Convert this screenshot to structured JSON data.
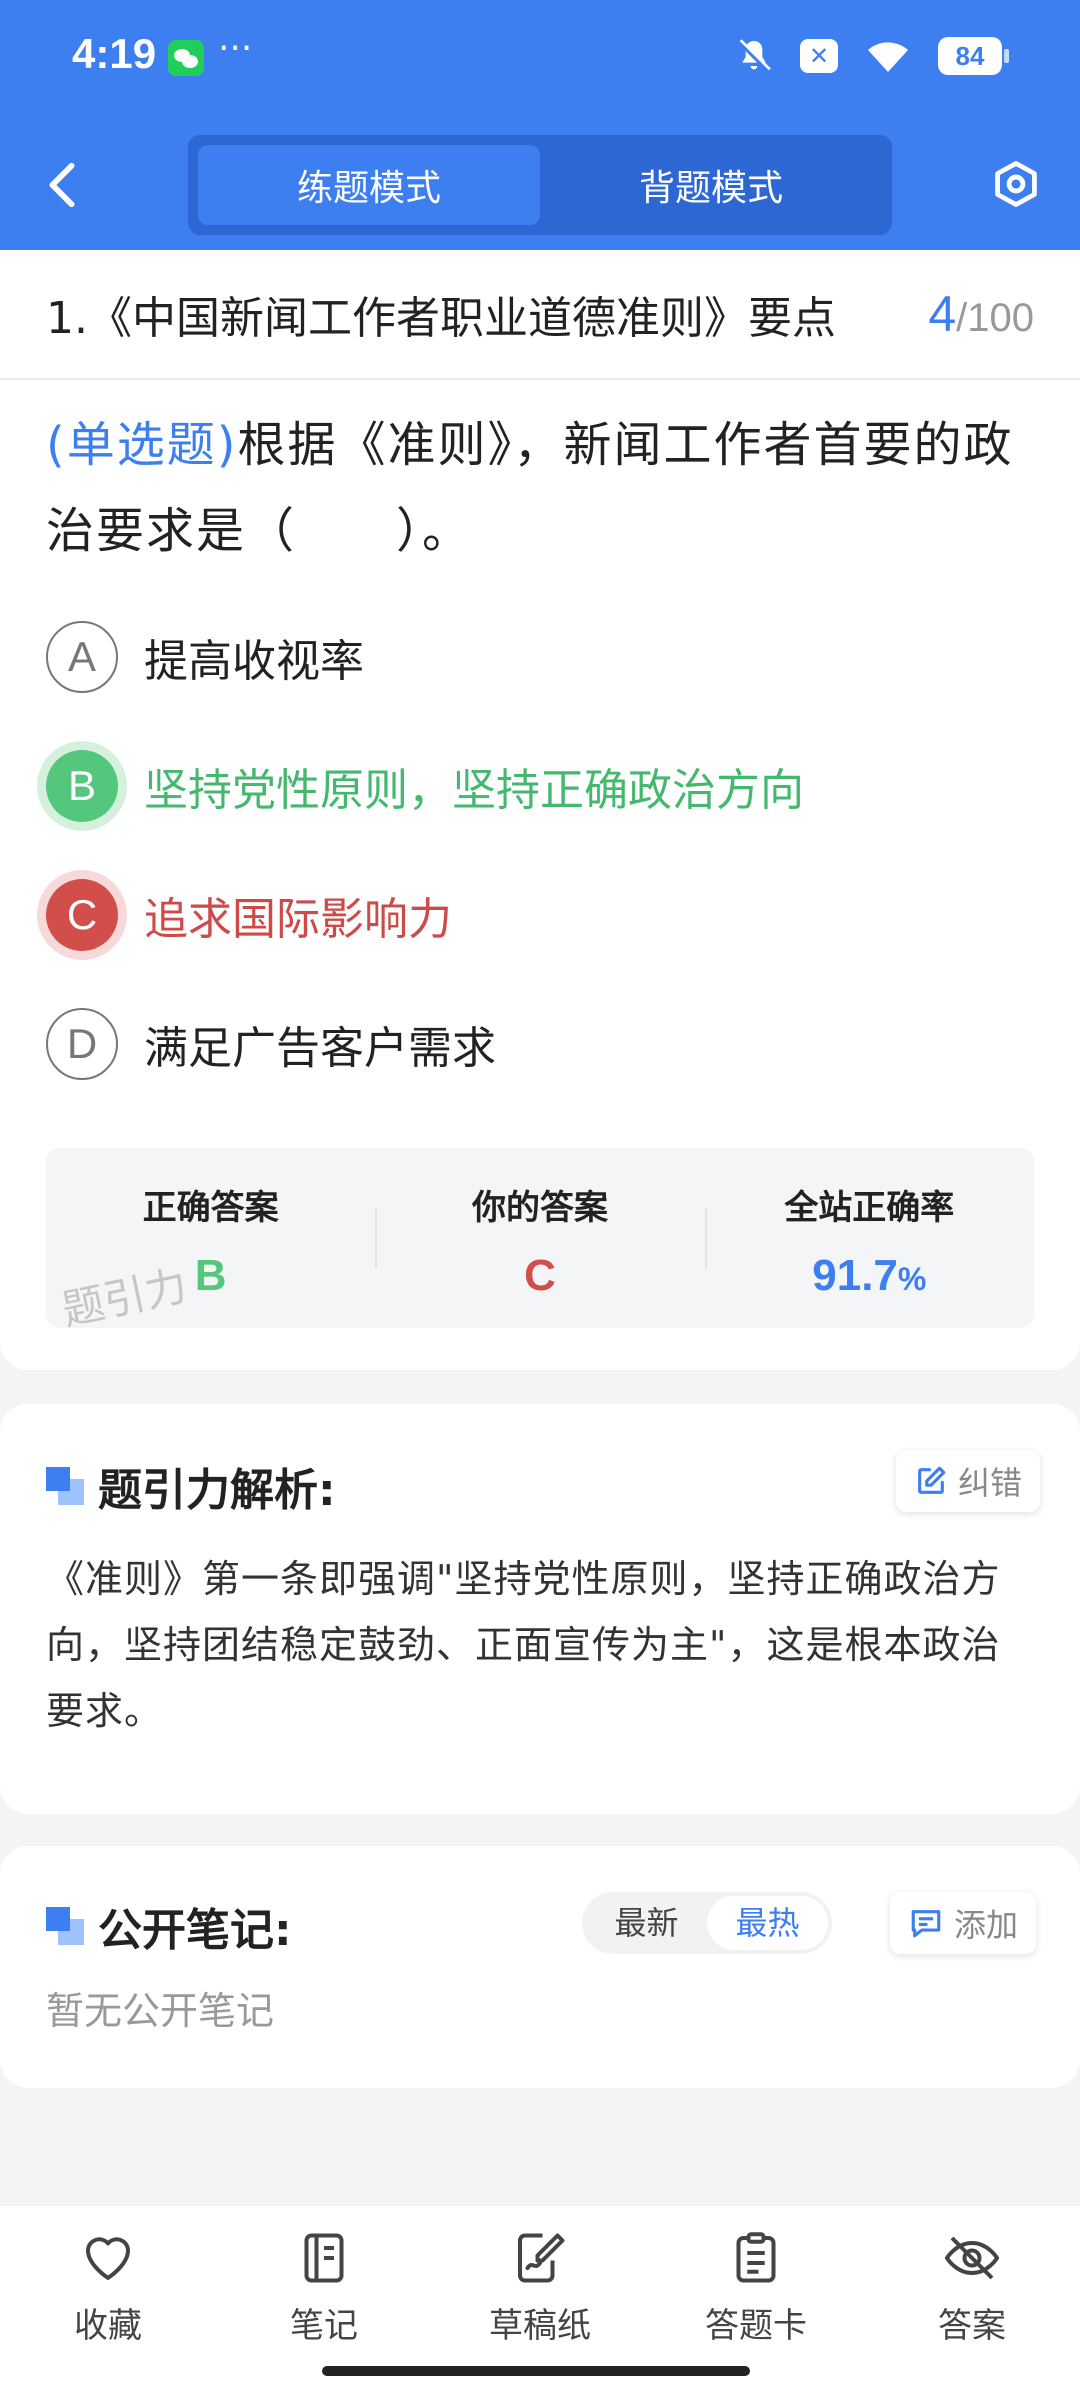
{
  "status_bar": {
    "time": "4:19",
    "dots": "···",
    "x_badge": "✕",
    "battery": "84"
  },
  "header": {
    "tabs": [
      {
        "label": "练题模式",
        "active": true
      },
      {
        "label": "背题模式",
        "active": false
      }
    ]
  },
  "question_header": {
    "title": "1.《中国新闻工作者职业道德准则》要点",
    "current": "4",
    "separator": "/",
    "total": "100"
  },
  "question": {
    "type_label": "(单选题)",
    "text": "根据《准则》，新闻工作者首要的政治要求是（　　）。",
    "options": [
      {
        "letter": "A",
        "text": "提高收视率",
        "state": "normal"
      },
      {
        "letter": "B",
        "text": "坚持党性原则，坚持正确政治方向",
        "state": "correct"
      },
      {
        "letter": "C",
        "text": "追求国际影响力",
        "state": "wrong"
      },
      {
        "letter": "D",
        "text": "满足广告客户需求",
        "state": "normal"
      }
    ]
  },
  "summary": {
    "correct_label": "正确答案",
    "correct_value": "B",
    "yours_label": "你的答案",
    "yours_value": "C",
    "rate_label": "全站正确率",
    "rate_value": "91.7",
    "rate_unit": "%",
    "watermark": "题引力"
  },
  "analysis": {
    "title": "题引力解析:",
    "report_label": "纠错",
    "text": "《准则》第一条即强调\"坚持党性原则，坚持正确政治方向，坚持团结稳定鼓劲、正面宣传为主\"，这是根本政治要求。"
  },
  "notes": {
    "title": "公开笔记:",
    "sort_options": [
      {
        "label": "最新",
        "active": false
      },
      {
        "label": "最热",
        "active": true
      }
    ],
    "add_label": "添加",
    "empty_text": "暂无公开笔记"
  },
  "bottom_nav": [
    {
      "label": "收藏",
      "icon": "heart-icon"
    },
    {
      "label": "笔记",
      "icon": "notebook-icon"
    },
    {
      "label": "草稿纸",
      "icon": "draft-paper-icon"
    },
    {
      "label": "答题卡",
      "icon": "answer-card-icon"
    },
    {
      "label": "答案",
      "icon": "eye-off-icon"
    }
  ],
  "colors": {
    "primary": "#3d7ef0",
    "correct": "#54c77c",
    "wrong": "#d24e4a"
  }
}
